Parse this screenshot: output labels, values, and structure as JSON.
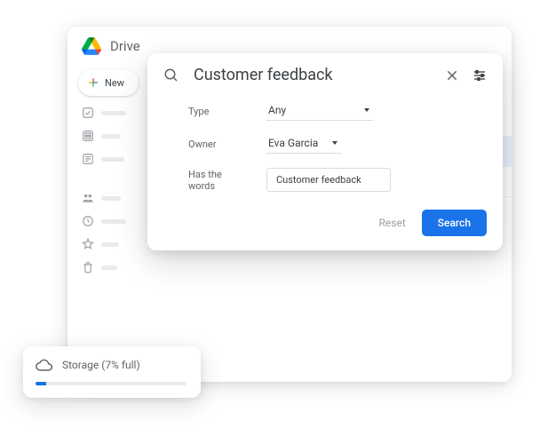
{
  "app": {
    "name": "Drive"
  },
  "sidebar": {
    "new_label": "New",
    "items": [
      {
        "icon": "check-square"
      },
      {
        "icon": "storage-square"
      },
      {
        "icon": "news-square"
      },
      {
        "icon": "people"
      },
      {
        "icon": "clock"
      },
      {
        "icon": "star"
      },
      {
        "icon": "trash"
      }
    ]
  },
  "search": {
    "query": "Customer feedback",
    "filters": {
      "type": {
        "label": "Type",
        "value": "Any"
      },
      "owner": {
        "label": "Owner",
        "value": "Eva Garcia"
      },
      "has_words": {
        "label": "Has the words",
        "value": "Customer feedback"
      }
    },
    "reset_label": "Reset",
    "search_label": "Search"
  },
  "storage": {
    "label": "Storage (7% full)",
    "percent": 7
  },
  "colors": {
    "accent": "#1a73e8",
    "muted": "#5f6368",
    "selected_bg": "#e8f0fe"
  }
}
